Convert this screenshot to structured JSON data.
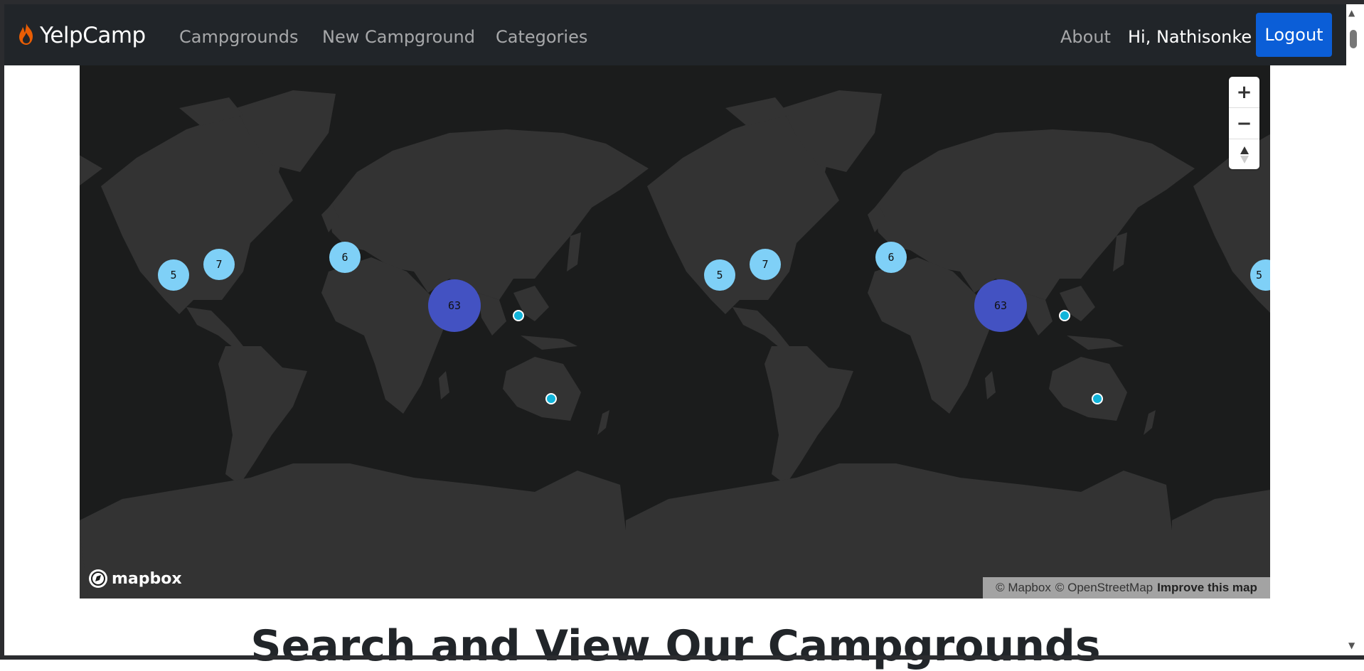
{
  "navbar": {
    "brand": "YelpCamp",
    "brand_icon": "flame-icon",
    "brand_icon_color": "#e85d04",
    "links": [
      "Campgrounds",
      "New Campground",
      "Categories"
    ],
    "about": "About",
    "greeting": "Hi, Nathisonke",
    "logout": "Logout",
    "logout_color": "#0b5ed7"
  },
  "map": {
    "clusters_left": [
      {
        "count": "5",
        "size": "small"
      },
      {
        "count": "7",
        "size": "small"
      },
      {
        "count": "6",
        "size": "small"
      },
      {
        "count": "63",
        "size": "large"
      }
    ],
    "clusters_right": [
      {
        "count": "5",
        "size": "small"
      },
      {
        "count": "7",
        "size": "small"
      },
      {
        "count": "6",
        "size": "small"
      },
      {
        "count": "63",
        "size": "large"
      },
      {
        "count": "5",
        "size": "small"
      }
    ],
    "zoom_in": "+",
    "zoom_out": "−",
    "compass": "compass-icon",
    "logo_text": "mapbox",
    "attribution_mapbox": "© Mapbox",
    "attribution_osm": "© OpenStreetMap",
    "improve": "Improve this map",
    "colors": {
      "small_cluster": "#7fd0f7",
      "large_cluster": "#4352c2",
      "pin": "#11b4da",
      "land": "#333333",
      "water": "#1b1c1c"
    }
  },
  "heading": "Search and View Our Campgrounds"
}
